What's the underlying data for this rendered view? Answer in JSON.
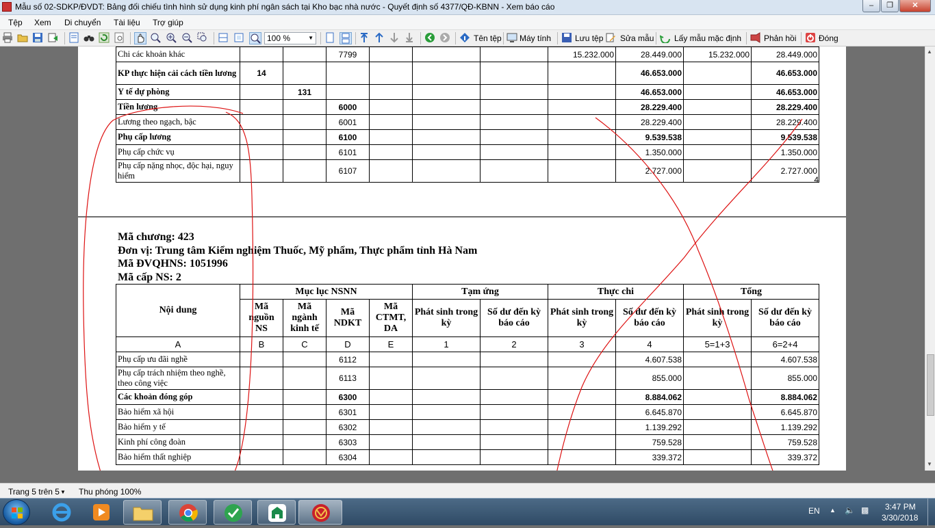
{
  "window": {
    "title": "Mẫu số 02-SDKP/ĐVDT: Bảng đối chiếu tình hình sử dụng kinh phí ngân sách tại Kho bạc nhà nước - Quyết định số 4377/QĐ-KBNN - Xem báo cáo"
  },
  "menu": [
    "Tệp",
    "Xem",
    "Di chuyển",
    "Tài liệu",
    "Trợ giúp"
  ],
  "toolbar": {
    "zoom_value": "100 %",
    "file_name": "Tên tệp",
    "computer": "Máy tính",
    "save_file": "Lưu tệp",
    "edit_template": "Sửa mẫu",
    "default_template": "Lấy mẫu mặc định",
    "feedback": "Phản hồi",
    "close": "Đóng"
  },
  "page4": {
    "rows": [
      {
        "label": "Chi các khoản khác",
        "b": "",
        "c": "",
        "d": "7799",
        "e": "",
        "c1": "",
        "c2": "",
        "c3": "15.232.000",
        "c4": "28.449.000",
        "c5": "15.232.000",
        "c6": "28.449.000",
        "bold": false
      },
      {
        "label": "KP thực hiện cải cách tiền lương",
        "b": "14",
        "c": "",
        "d": "",
        "e": "",
        "c1": "",
        "c2": "",
        "c3": "",
        "c4": "46.653.000",
        "c5": "",
        "c6": "46.653.000",
        "bold": true
      },
      {
        "label": "Y tế dự phòng",
        "b": "",
        "c": "131",
        "d": "",
        "e": "",
        "c1": "",
        "c2": "",
        "c3": "",
        "c4": "46.653.000",
        "c5": "",
        "c6": "46.653.000",
        "bold": true
      },
      {
        "label": "Tiền lương",
        "b": "",
        "c": "",
        "d": "6000",
        "e": "",
        "c1": "",
        "c2": "",
        "c3": "",
        "c4": "28.229.400",
        "c5": "",
        "c6": "28.229.400",
        "bold": true
      },
      {
        "label": "Lương theo ngạch, bậc",
        "b": "",
        "c": "",
        "d": "6001",
        "e": "",
        "c1": "",
        "c2": "",
        "c3": "",
        "c4": "28.229.400",
        "c5": "",
        "c6": "28.229.400",
        "bold": false
      },
      {
        "label": "Phụ cấp lương",
        "b": "",
        "c": "",
        "d": "6100",
        "e": "",
        "c1": "",
        "c2": "",
        "c3": "",
        "c4": "9.539.538",
        "c5": "",
        "c6": "9.539.538",
        "bold": true
      },
      {
        "label": "Phụ cấp chức vụ",
        "b": "",
        "c": "",
        "d": "6101",
        "e": "",
        "c1": "",
        "c2": "",
        "c3": "",
        "c4": "1.350.000",
        "c5": "",
        "c6": "1.350.000",
        "bold": false
      },
      {
        "label": "Phụ cấp nặng nhọc, độc hại, nguy hiểm",
        "b": "",
        "c": "",
        "d": "6107",
        "e": "",
        "c1": "",
        "c2": "",
        "c3": "",
        "c4": "2.727.000",
        "c5": "",
        "c6": "2.727.000",
        "bold": false
      }
    ],
    "page_number": "4"
  },
  "page5": {
    "chapter": "Mã chương: 423",
    "unit": "Đơn vị: Trung tâm Kiểm nghiệm Thuốc, Mỹ phẩm, Thực phẩm tỉnh Hà Nam",
    "dvqhns": "Mã ĐVQHNS: 1051996",
    "level": "Mã cấp NS: 2",
    "header": {
      "noi_dung": "Nội dung",
      "muc_luc": "Mục lục NSNN",
      "tam_ung": "Tạm ứng",
      "thuc_chi": "Thực chi",
      "tong": "Tổng",
      "ma_nguon": "Mã nguồn NS",
      "ma_nganh": "Mã ngành kinh tế",
      "ma_ndkt": "Mã NDKT",
      "ma_ctmt": "Mã CTMT, DA",
      "phat_sinh": "Phát sinh trong kỳ",
      "so_du": "Số dư đến kỳ báo cáo"
    },
    "letters": [
      "A",
      "B",
      "C",
      "D",
      "E",
      "1",
      "2",
      "3",
      "4",
      "5=1+3",
      "6=2+4"
    ],
    "rows": [
      {
        "label": "Phụ cấp ưu đãi nghề",
        "b": "",
        "c": "",
        "d": "6112",
        "e": "",
        "c1": "",
        "c2": "",
        "c3": "",
        "c4": "4.607.538",
        "c5": "",
        "c6": "4.607.538",
        "bold": false
      },
      {
        "label": "Phụ cấp trách nhiệm theo nghề, theo công việc",
        "b": "",
        "c": "",
        "d": "6113",
        "e": "",
        "c1": "",
        "c2": "",
        "c3": "",
        "c4": "855.000",
        "c5": "",
        "c6": "855.000",
        "bold": false
      },
      {
        "label": "Các khoản đóng góp",
        "b": "",
        "c": "",
        "d": "6300",
        "e": "",
        "c1": "",
        "c2": "",
        "c3": "",
        "c4": "8.884.062",
        "c5": "",
        "c6": "8.884.062",
        "bold": true
      },
      {
        "label": "Bảo hiểm xã hội",
        "b": "",
        "c": "",
        "d": "6301",
        "e": "",
        "c1": "",
        "c2": "",
        "c3": "",
        "c4": "6.645.870",
        "c5": "",
        "c6": "6.645.870",
        "bold": false
      },
      {
        "label": "Bảo hiểm y tế",
        "b": "",
        "c": "",
        "d": "6302",
        "e": "",
        "c1": "",
        "c2": "",
        "c3": "",
        "c4": "1.139.292",
        "c5": "",
        "c6": "1.139.292",
        "bold": false
      },
      {
        "label": "Kinh phí công đoàn",
        "b": "",
        "c": "",
        "d": "6303",
        "e": "",
        "c1": "",
        "c2": "",
        "c3": "",
        "c4": "759.528",
        "c5": "",
        "c6": "759.528",
        "bold": false
      },
      {
        "label": "Bảo hiểm thất nghiệp",
        "b": "",
        "c": "",
        "d": "6304",
        "e": "",
        "c1": "",
        "c2": "",
        "c3": "",
        "c4": "339.372",
        "c5": "",
        "c6": "339.372",
        "bold": false
      }
    ]
  },
  "status": {
    "page_info": "Trang 5 trên 5",
    "zoom_info": "Thu phóng 100%"
  },
  "tray": {
    "lang": "EN",
    "time": "3:47 PM",
    "date": "3/30/2018"
  }
}
